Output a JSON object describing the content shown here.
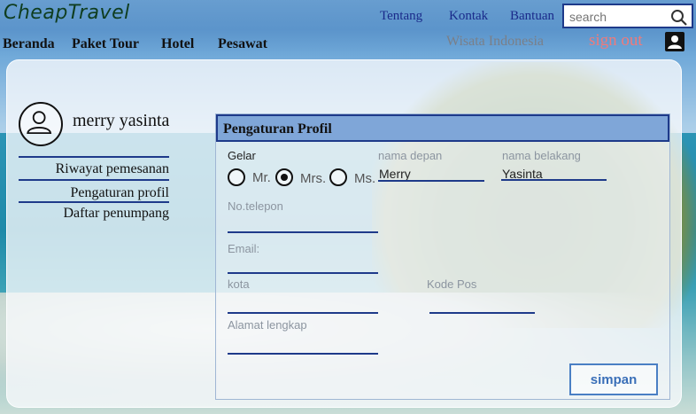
{
  "header": {
    "logo": "CheapTravel",
    "links": [
      "Tentang",
      "Kontak",
      "Bantuan"
    ],
    "search_placeholder": "search"
  },
  "nav": {
    "items": [
      "Beranda",
      "Paket Tour",
      "Hotel",
      "Pesawat"
    ],
    "wisata": "Wisata Indonesia",
    "signout": "sign out"
  },
  "profile": {
    "username": "merry yasinta"
  },
  "sidebar": {
    "items": [
      "Riwayat pemesanan",
      "Pengaturan profil",
      "Daftar penumpang"
    ]
  },
  "form": {
    "title": "Pengaturan Profil",
    "gelar_label": "Gelar",
    "titles": [
      {
        "label": "Mr.",
        "selected": false
      },
      {
        "label": "Mrs.",
        "selected": true
      },
      {
        "label": "Ms.",
        "selected": false
      }
    ],
    "first_name_label": "nama depan",
    "first_name_value": "Merry",
    "last_name_label": "nama belakang",
    "last_name_value": "Yasinta",
    "phone_label": "No.telepon",
    "email_label": "Email:",
    "city_label": "kota",
    "postal_label": "Kode Pos",
    "address_label": "Alamat lengkap",
    "save_label": "simpan"
  },
  "colors": {
    "accent": "#1e3a8a",
    "header_fill": "#7fa6d8",
    "signout": "#f07a7a",
    "button_text": "#3a6fb8"
  }
}
